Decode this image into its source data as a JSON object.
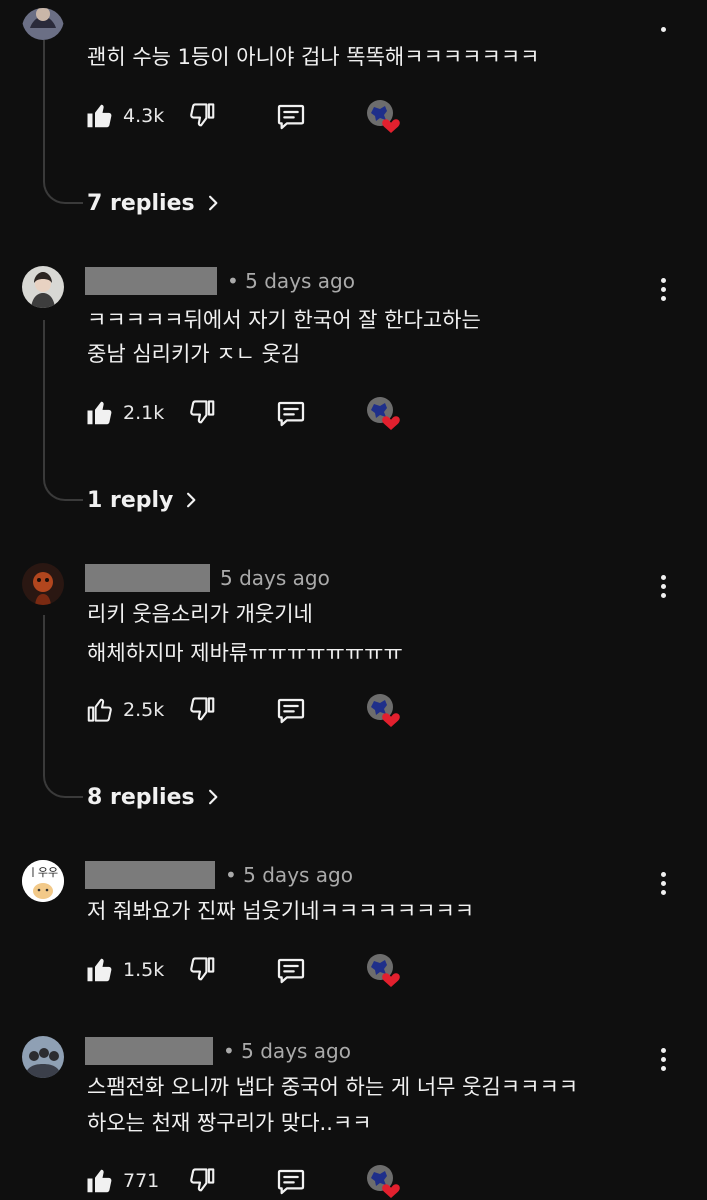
{
  "comments": [
    {
      "id": "c1",
      "date": "",
      "lines": [
        "괜히 수능 1등이 아니야 겁나 똑똑해ㅋㅋㅋㅋㅋㅋㅋ"
      ],
      "likes": "4.3k",
      "replies_label": "7 replies"
    },
    {
      "id": "c2",
      "date": "• 5 days ago",
      "lines": [
        "ㅋㅋㅋㅋㅋ뒤에서 자기 한국어 잘 한다고하는",
        "중남 심리키가 ㅈㄴ 웃김"
      ],
      "likes": "2.1k",
      "replies_label": "1 reply"
    },
    {
      "id": "c3",
      "date": "5 days ago",
      "lines": [
        "리키 웃음소리가 개웃기네",
        "해체하지마 제바류ㅠㅠㅠㅠㅠㅠㅠㅠ"
      ],
      "likes": "2.5k",
      "replies_label": "8 replies"
    },
    {
      "id": "c4",
      "date": "• 5 days ago",
      "lines": [
        "저 줘봐요가 진짜 넘웃기네ㅋㅋㅋㅋㅋㅋㅋㅋ"
      ],
      "likes": "1.5k",
      "replies_label": ""
    },
    {
      "id": "c5",
      "date": "• 5 days ago",
      "lines": [
        "스팸전화 오니까 냅다 중국어 하는 게 너무 웃김ㅋㅋㅋㅋ",
        "하오는 천재 짱구리가 맞다..ㅋㅋ"
      ],
      "likes": "771",
      "replies_label": ""
    }
  ],
  "avatar_c4_text": "ㅣ우우",
  "colors": {
    "background": "#0f0f0f",
    "text": "#f1f1f1",
    "secondary_text": "#aaaaaa",
    "redaction": "#7b7b7b",
    "thread_line": "#3a3a3a",
    "heart": "#e2202e"
  },
  "icons": [
    "like-icon",
    "dislike-icon",
    "reply-icon",
    "creator-heart-icon",
    "chevron-right-icon",
    "more-vert-icon"
  ]
}
